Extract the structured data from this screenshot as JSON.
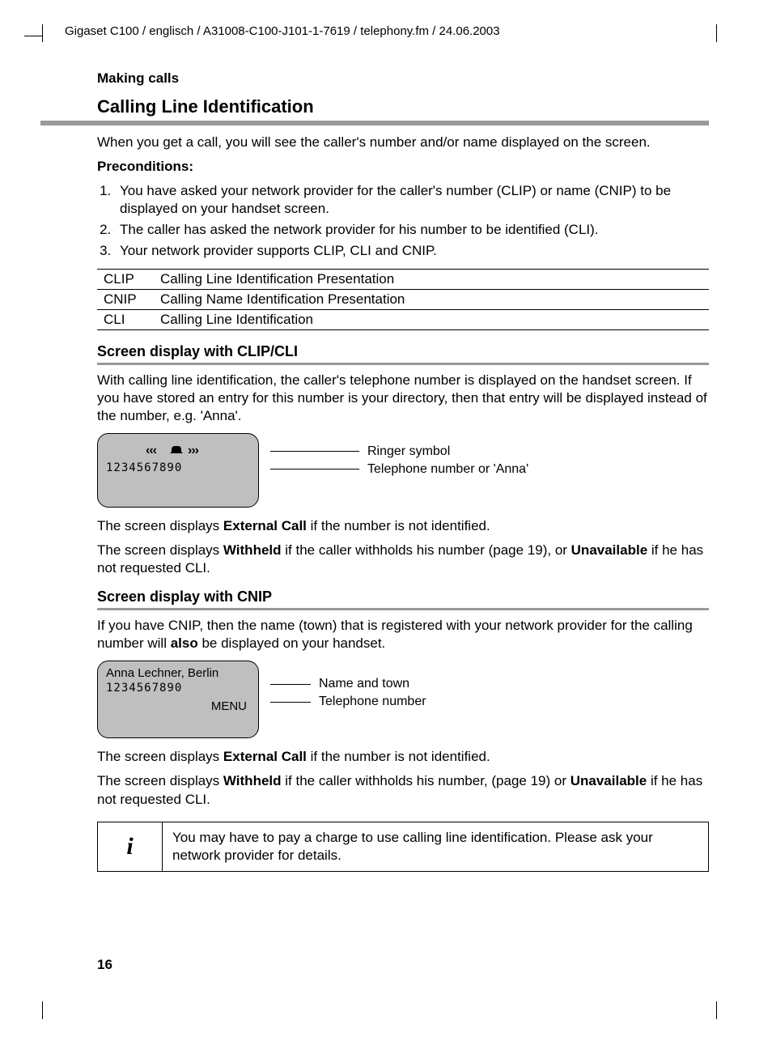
{
  "header_path": "Gigaset C100 / englisch / A31008-C100-J101-1-7619 / telephony.fm / 24.06.2003",
  "section_label": "Making calls",
  "main_heading": "Calling Line Identification",
  "intro": "When you get a call, you will see the caller's number and/or name  displayed on the screen.",
  "preconditions_label": "Preconditions:",
  "preconditions": [
    "You have asked your network provider for the caller's number (CLIP) or name (CNIP) to be displayed on your handset screen.",
    "The caller has asked the network provider for his number to be identified (CLI).",
    "Your network provider supports CLIP, CLI and CNIP."
  ],
  "def_table": [
    {
      "abbr": "CLIP",
      "full": "Calling Line Identification Presentation"
    },
    {
      "abbr": "CNIP",
      "full": "Calling Name Identification Presentation"
    },
    {
      "abbr": "CLI",
      "full": "Calling Line Identification"
    }
  ],
  "clip": {
    "heading": "Screen display with CLIP/CLI",
    "para": "With calling line identification, the caller's telephone number is displayed on the handset screen. If you have stored an entry for this number is your directory, then that entry will be displayed instead of the number, e.g. 'Anna'.",
    "screen_ringer": "‹‹‹ 🔔 ›››",
    "screen_number": "1234567890",
    "callout1": "Ringer symbol",
    "callout2": "Telephone number or 'Anna'",
    "after1_pre": "The screen displays ",
    "after1_bold": "External Call",
    "after1_post": " if the number is not identified.",
    "after2_pre": "The screen displays ",
    "after2_bold1": "Withheld",
    "after2_mid": " if the caller withholds his number (page 19), or ",
    "after2_bold2": "Unavailable",
    "after2_post": " if he has not requested CLI."
  },
  "cnip": {
    "heading": "Screen display with CNIP",
    "para_pre": "If you have CNIP, then the name (town) that is registered with your network provider for the calling number will ",
    "para_bold": "also",
    "para_post": " be displayed on your handset.",
    "screen_name": "Anna Lechner, Berlin",
    "screen_number": "1234567890",
    "screen_menu": "MENU",
    "callout1": "Name and town",
    "callout2": "Telephone number",
    "after1_pre": "The screen displays ",
    "after1_bold": "External Call",
    "after1_post": " if the number is not identified.",
    "after2_pre": "The screen displays ",
    "after2_bold1": "Withheld",
    "after2_mid": " if the caller withholds his number, (page 19) or ",
    "after2_bold2": "Unavailable",
    "after2_post": "  if he has not requested CLI."
  },
  "info_icon": "i",
  "info_text": "You may have to pay a charge to use calling line identification. Please ask your network provider for details.",
  "page_number": "16"
}
